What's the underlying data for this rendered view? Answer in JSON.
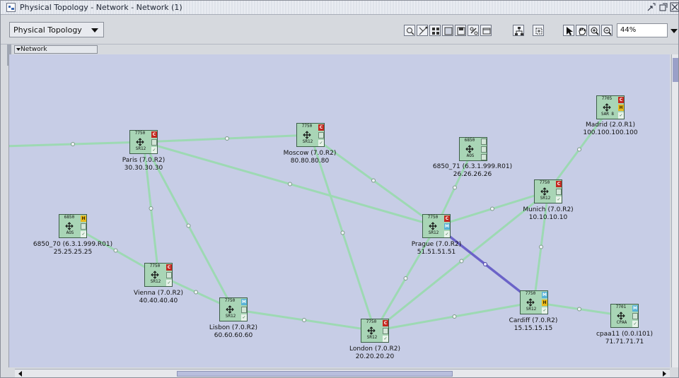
{
  "window": {
    "title": "Physical Topology - Network - Network (1)",
    "buttons": [
      "undock",
      "maximize",
      "close"
    ]
  },
  "toolbar": {
    "view_select": "Physical Topology",
    "zoom": "44%"
  },
  "breadcrumb": {
    "label": "Network"
  },
  "nodes": [
    {
      "id": "paris",
      "model": "7750",
      "type": "SR12",
      "name": "Paris (7.0.R2)",
      "ip": "30.30.30.30",
      "flags": [
        "c",
        "e",
        "k"
      ]
    },
    {
      "id": "moscow",
      "model": "7750",
      "type": "SR12",
      "name": "Moscow (7.0.R2)",
      "ip": "80.80.80.80",
      "flags": [
        "c",
        "e",
        "k"
      ]
    },
    {
      "id": "n6850a",
      "model": "6850",
      "type": "AOS",
      "name": "6850_71 (6.3.1.999.R01)",
      "ip": "26.26.26.26",
      "flags": [
        "e",
        "e",
        "e"
      ]
    },
    {
      "id": "madrid",
      "model": "7705",
      "type": "SAR 8",
      "name": "Madrid (2.0.R1)",
      "ip": "100.100.100.100",
      "flags": [
        "c",
        "h",
        "k"
      ]
    },
    {
      "id": "munich",
      "model": "7750",
      "type": "SR12",
      "name": "Munich (7.0.R2)",
      "ip": "10.10.10.10",
      "flags": [
        "c",
        "e",
        "k"
      ]
    },
    {
      "id": "prague",
      "model": "7750",
      "type": "SR12",
      "name": "Prague (7.0.R2)",
      "ip": "51.51.51.51",
      "flags": [
        "c",
        "b",
        "k"
      ]
    },
    {
      "id": "n6850b",
      "model": "6850",
      "type": "AOS",
      "name": "6850_70 (6.3.1.999.R01)",
      "ip": "25.25.25.25",
      "flags": [
        "h",
        "e",
        "k"
      ]
    },
    {
      "id": "vienna",
      "model": "7750",
      "type": "SR12",
      "name": "Vienna (7.0.R2)",
      "ip": "40.40.40.40",
      "flags": [
        "c",
        "e",
        "k"
      ]
    },
    {
      "id": "lisbon",
      "model": "7750",
      "type": "SR12",
      "name": "Lisbon (7.0.R2)",
      "ip": "60.60.60.60",
      "flags": [
        "b",
        "e",
        "k"
      ]
    },
    {
      "id": "london",
      "model": "7750",
      "type": "SR12",
      "name": "London (7.0.R2)",
      "ip": "20.20.20.20",
      "flags": [
        "c",
        "e",
        "k"
      ]
    },
    {
      "id": "cardiff",
      "model": "7750",
      "type": "SR12",
      "name": "Cardiff (7.0.R2)",
      "ip": "15.15.15.15",
      "flags": [
        "b",
        "h",
        "k"
      ]
    },
    {
      "id": "cpaa",
      "model": "7701",
      "type": "CPAA",
      "name": "cpaa11 (0.0.I101)",
      "ip": "71.71.71.71",
      "flags": [
        "b",
        "e",
        "k"
      ]
    }
  ],
  "links": [
    {
      "from": "offscreen-left",
      "to": "paris"
    },
    {
      "from": "paris",
      "to": "moscow"
    },
    {
      "from": "paris",
      "to": "prague"
    },
    {
      "from": "paris",
      "to": "vienna"
    },
    {
      "from": "paris",
      "to": "lisbon"
    },
    {
      "from": "moscow",
      "to": "prague"
    },
    {
      "from": "moscow",
      "to": "london"
    },
    {
      "from": "n6850a",
      "to": "prague"
    },
    {
      "from": "madrid",
      "to": "munich"
    },
    {
      "from": "munich",
      "to": "prague"
    },
    {
      "from": "munich",
      "to": "cardiff"
    },
    {
      "from": "munich",
      "to": "london"
    },
    {
      "from": "prague",
      "to": "cardiff",
      "highlight": true
    },
    {
      "from": "prague",
      "to": "london"
    },
    {
      "from": "n6850b",
      "to": "vienna"
    },
    {
      "from": "vienna",
      "to": "lisbon"
    },
    {
      "from": "lisbon",
      "to": "london"
    },
    {
      "from": "london",
      "to": "cardiff"
    },
    {
      "from": "cardiff",
      "to": "cpaa"
    }
  ],
  "colors": {
    "link": "#9dd9b3",
    "link_highlight": "#6b63c8",
    "canvas": "#c7cde6",
    "node": "#a9d5b6"
  }
}
